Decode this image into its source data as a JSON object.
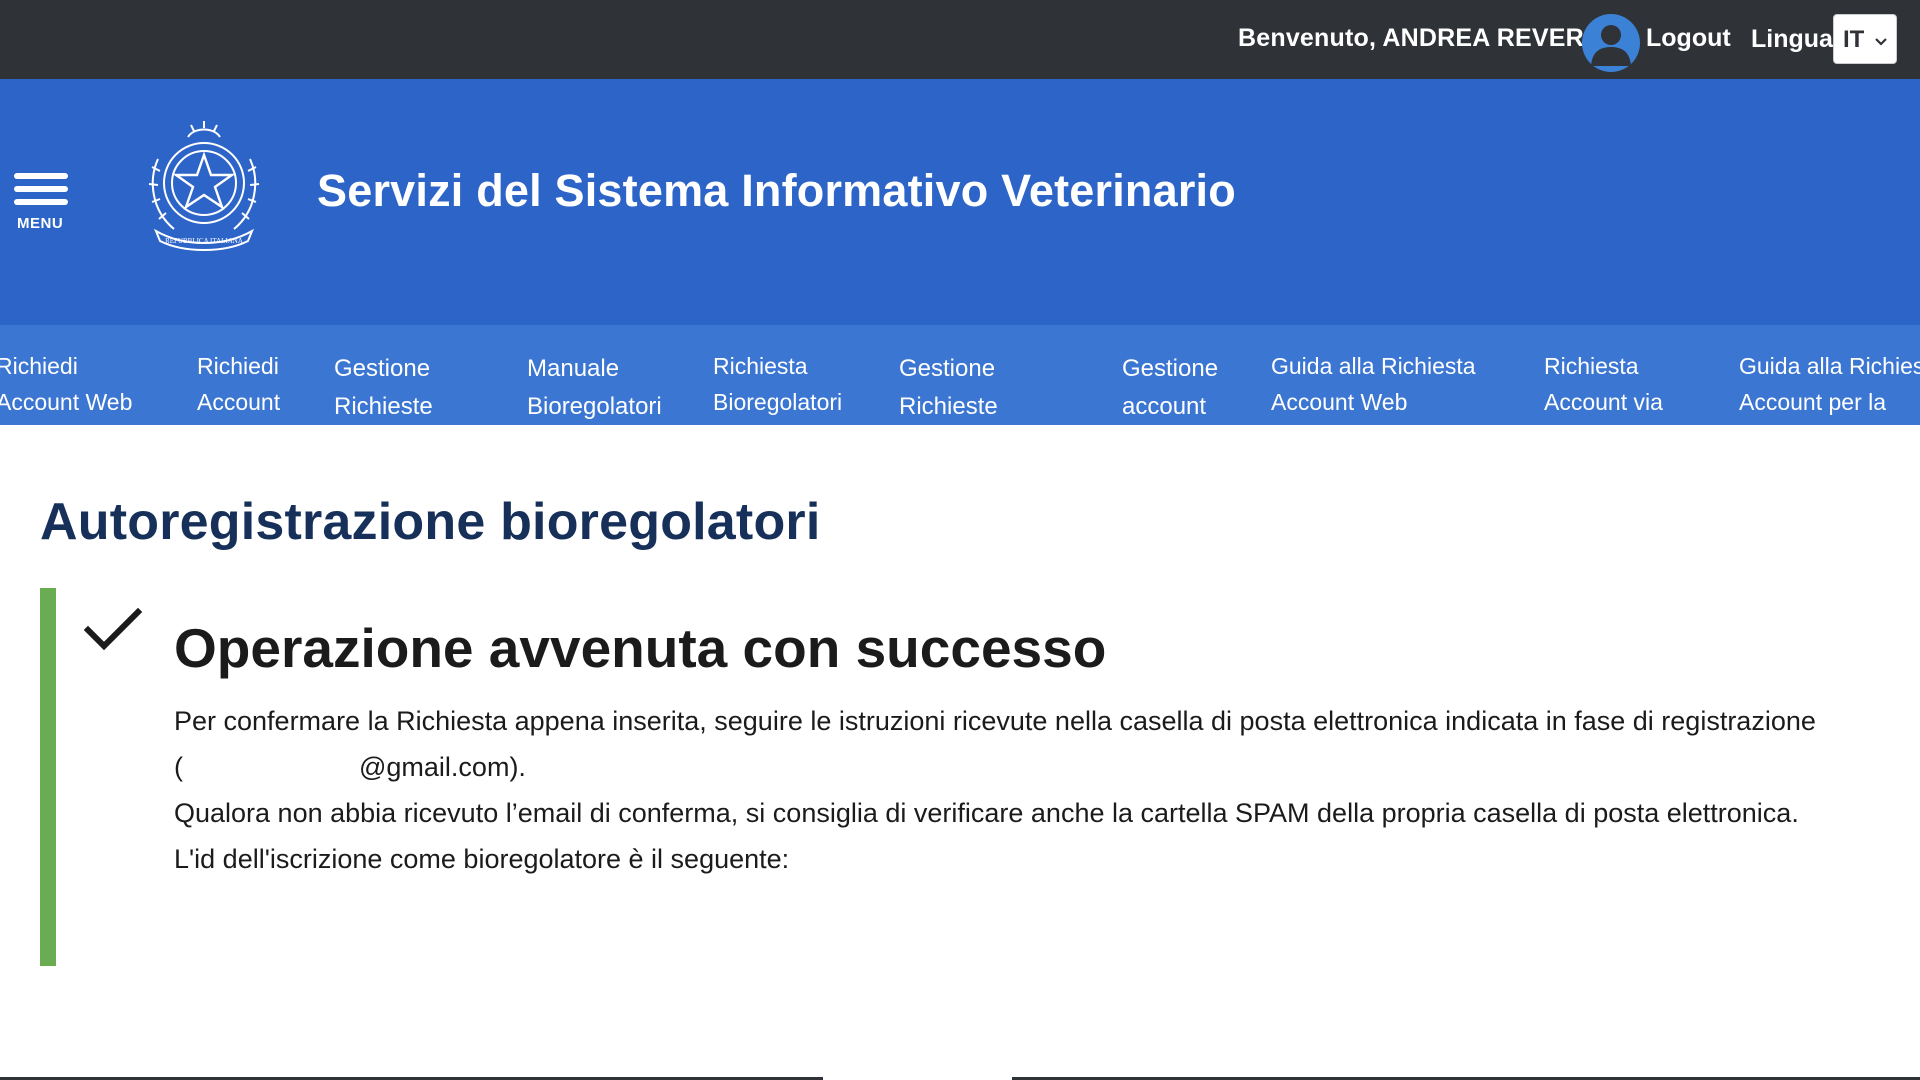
{
  "topbar": {
    "welcome": "Benvenuto, ANDREA REVERSI",
    "logout": "Logout",
    "lingua": "Lingua",
    "language_value": "IT",
    "background_color": "#2f3237"
  },
  "header": {
    "menu_label": "MENU",
    "title": "Servizi del Sistema Informativo Veterinario",
    "emblem_text": "REPUBBLICA ITALIANA",
    "background_color": "#2d64c8"
  },
  "nav": {
    "background_color": "#3b76d2",
    "items": [
      {
        "line1": "Richiedi",
        "line2": "Account Web"
      },
      {
        "line1": "Richiedi",
        "line2": "Account"
      },
      {
        "line1": "Gestione",
        "line2": "Richieste"
      },
      {
        "line1": "Manuale",
        "line2": "Bioregolatori"
      },
      {
        "line1": "Richiesta",
        "line2": "Bioregolatori"
      },
      {
        "line1": "Gestione",
        "line2": "Richieste"
      },
      {
        "line1": "Gestione",
        "line2": "account"
      },
      {
        "line1": "Guida alla Richiesta",
        "line2": "Account Web"
      },
      {
        "line1": "Richiesta",
        "line2": "Account via"
      },
      {
        "line1": "Guida alla Richiesta",
        "line2": "Account per la"
      }
    ]
  },
  "main": {
    "page_title": "Autoregistrazione bioregolatori",
    "alert": {
      "title": "Operazione avvenuta con successo",
      "line1": "Per confermare la Richiesta appena inserita, seguire le istruzioni ricevute nella casella di posta elettronica indicata in fase di registrazione",
      "email_prefix": "(",
      "email_suffix": "@gmail.com).",
      "line3": "Qualora non abbia ricevuto l’email di conferma, si consiglia di verificare anche la cartella SPAM della propria casella di posta elettronica.",
      "line4": "L'id dell'iscrizione come bioregolatore è il seguente:",
      "accent_color": "#6aac52"
    }
  },
  "icons": {
    "menu": "hamburger-icon",
    "user": "user-icon",
    "chevron": "chevron-down-icon",
    "emblem": "emblem-icon",
    "check": "check-icon"
  }
}
